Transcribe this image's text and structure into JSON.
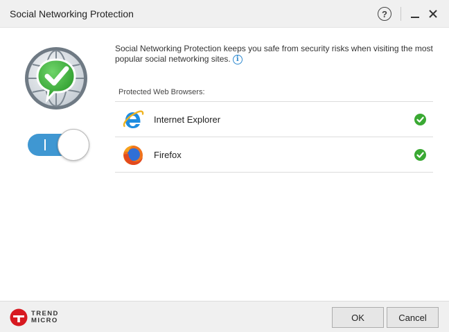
{
  "window": {
    "title": "Social Networking Protection",
    "controls": {
      "help": "?",
      "minimize": "minimize-icon",
      "close": "close-icon"
    }
  },
  "status": {
    "icon": "globe-check-icon",
    "toggle_state": "on"
  },
  "description": "Social Networking Protection keeps you safe from security risks when visiting the most popular social networking sites.",
  "info_icon_glyph": "i",
  "browsers": {
    "label": "Protected Web Browsers:",
    "items": [
      {
        "name": "Internet Explorer",
        "icon": "internet-explorer-icon",
        "protected": true
      },
      {
        "name": "Firefox",
        "icon": "firefox-icon",
        "protected": true
      }
    ]
  },
  "footer": {
    "logo_line1": "TREND",
    "logo_line2": "MICRO",
    "ok_label": "OK",
    "cancel_label": "Cancel"
  },
  "colors": {
    "accent": "#3f97d2",
    "check_green": "#3aa933",
    "logo_red": "#d71920"
  }
}
